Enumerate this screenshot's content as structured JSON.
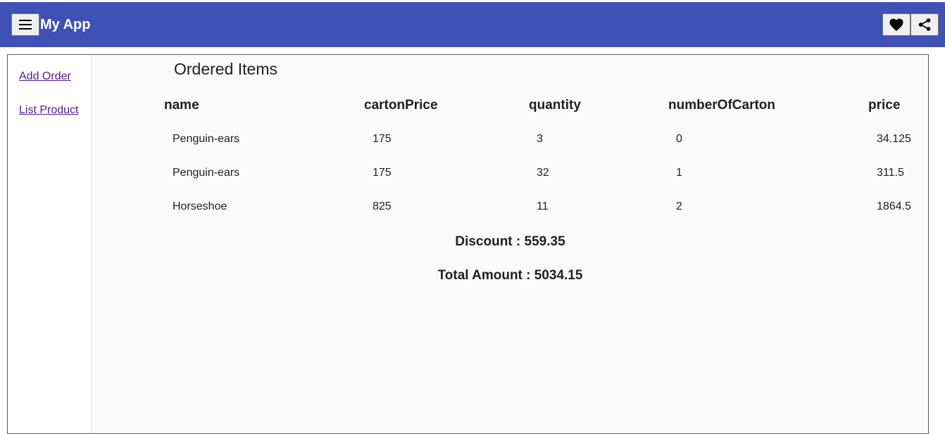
{
  "header": {
    "title": "My App",
    "menu_icon": "hamburger-icon",
    "favorite_icon": "heart-icon",
    "share_icon": "share-icon",
    "bar_color": "#3f51b5"
  },
  "sidebar": {
    "items": [
      {
        "label": "Add Order"
      },
      {
        "label": "List Product"
      }
    ],
    "link_color": "#551a8b"
  },
  "main": {
    "title": "Ordered Items",
    "columns": [
      "name",
      "cartonPrice",
      "quantity",
      "numberOfCarton",
      "price"
    ],
    "rows": [
      {
        "name": "Penguin-ears",
        "cartonPrice": "175",
        "quantity": "3",
        "numberOfCarton": "0",
        "price": "34.125"
      },
      {
        "name": "Penguin-ears",
        "cartonPrice": "175",
        "quantity": "32",
        "numberOfCarton": "1",
        "price": "311.5"
      },
      {
        "name": "Horseshoe",
        "cartonPrice": "825",
        "quantity": "11",
        "numberOfCarton": "2",
        "price": "1864.5"
      }
    ],
    "discount": "Discount : 559.35",
    "total": "Total Amount : 5034.15"
  }
}
